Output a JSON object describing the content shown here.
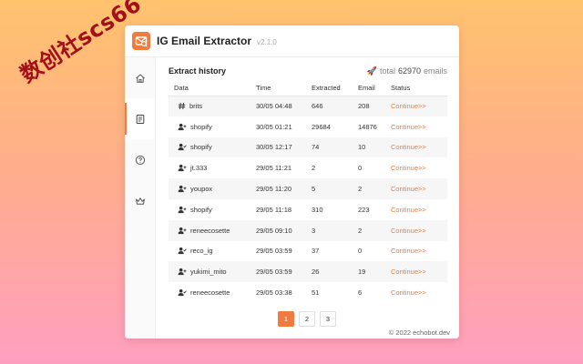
{
  "watermark": "数创社scs66",
  "app": {
    "title": "IG Email Extractor",
    "version": "v2.1.0"
  },
  "sidebar": {
    "items": [
      {
        "icon": "home-icon",
        "active": false
      },
      {
        "icon": "document-icon",
        "active": true
      },
      {
        "icon": "help-icon",
        "active": false
      },
      {
        "icon": "crown-icon",
        "active": false
      }
    ]
  },
  "history": {
    "title": "Extract history",
    "total_label": "total",
    "total_value": "62970",
    "total_unit": "emails",
    "columns": [
      "Data",
      "Time",
      "Extracted",
      "Email",
      "Status"
    ],
    "rows": [
      {
        "icon": "hashtag-icon",
        "data": "brits",
        "time": "30/05 04:48",
        "extracted": "646",
        "email": "208",
        "status": "Continue>>"
      },
      {
        "icon": "user-follow-icon",
        "data": "shopify",
        "time": "30/05 01:21",
        "extracted": "29684",
        "email": "14876",
        "status": "Continue>>"
      },
      {
        "icon": "user-check-icon",
        "data": "shopify",
        "time": "30/05 12:17",
        "extracted": "74",
        "email": "10",
        "status": "Continue>>"
      },
      {
        "icon": "user-follow-icon",
        "data": "jt.333",
        "time": "29/05 11:21",
        "extracted": "2",
        "email": "0",
        "status": "Continue>>"
      },
      {
        "icon": "user-follow-icon",
        "data": "youpox",
        "time": "29/05 11:20",
        "extracted": "5",
        "email": "2",
        "status": "Continue>>"
      },
      {
        "icon": "user-follow-icon",
        "data": "shopify",
        "time": "29/05 11:18",
        "extracted": "310",
        "email": "223",
        "status": "Continue>>"
      },
      {
        "icon": "user-follow-icon",
        "data": "reneecosette",
        "time": "29/05 09:10",
        "extracted": "3",
        "email": "2",
        "status": "Continue>>"
      },
      {
        "icon": "user-check-icon",
        "data": "reco_ig",
        "time": "29/05 03:59",
        "extracted": "37",
        "email": "0",
        "status": "Continue>>"
      },
      {
        "icon": "user-follow-icon",
        "data": "yukimi_mito",
        "time": "29/05 03:59",
        "extracted": "26",
        "email": "19",
        "status": "Continue>>"
      },
      {
        "icon": "user-check-icon",
        "data": "reneecosette",
        "time": "29/05 03:38",
        "extracted": "51",
        "email": "6",
        "status": "Continue>>"
      }
    ]
  },
  "pagination": {
    "pages": [
      "1",
      "2",
      "3"
    ],
    "current": "1"
  },
  "footer": "© 2022 echobot.dev",
  "colors": {
    "accent": "#f07b3f",
    "row_stripe": "#f6f6f6"
  }
}
